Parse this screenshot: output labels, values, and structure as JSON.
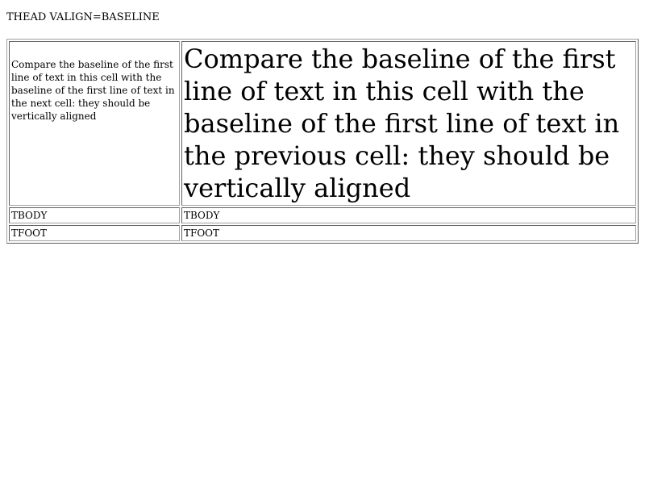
{
  "page": {
    "heading": "THEAD VALIGN=BASELINE"
  },
  "table": {
    "thead": {
      "cell_small": "Compare the baseline of the first line of text in this cell with the baseline of the first line of text in the next cell: they should be vertically aligned",
      "cell_large": "Compare the baseline of the first line of text in this cell with the baseline of the first line of text in the previous cell: they should be vertically aligned"
    },
    "tbody": [
      "TBODY",
      "TBODY"
    ],
    "tfoot": [
      "TFOOT",
      "TFOOT"
    ]
  }
}
